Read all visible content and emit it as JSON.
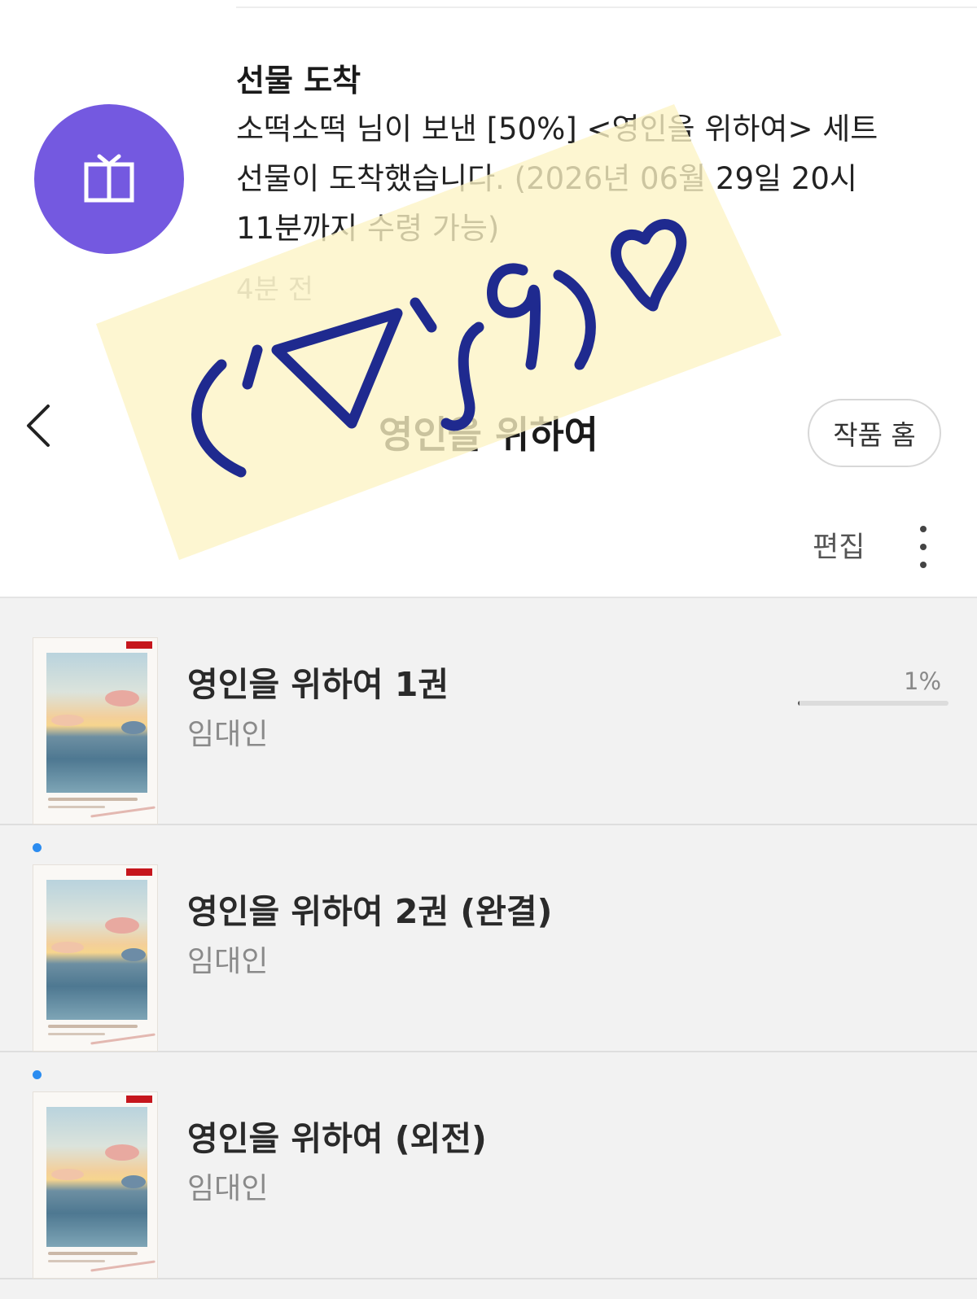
{
  "notification": {
    "title": "선물 도착",
    "line1": "소떡소떡 님이 보낸 [50%] <영인을 위하여> 세트",
    "line2": "선물이 도착했습니다. (2026년 06월 29일 20시",
    "line3": "11분까지 수령 가능)",
    "time": "4분 전",
    "icon": "gift-icon",
    "accent": "#7459e0"
  },
  "header": {
    "back_icon": "chevron-left-icon",
    "title": "영인을 위하여",
    "home_button": "작품 홈"
  },
  "toolbar": {
    "edit_label": "편집",
    "more_icon": "more-vertical-icon"
  },
  "books": [
    {
      "title": "영인을 위하여 1권",
      "author": "임대인",
      "progress_label": "1%",
      "progress": 0.01,
      "unread": false
    },
    {
      "title": "영인을 위하여 2권 (완결)",
      "author": "임대인",
      "unread": true
    },
    {
      "title": "영인을 위하여 (외전)",
      "author": "임대인",
      "unread": true
    }
  ],
  "sticker": {
    "emoticon": "(´▽`ʃ♡ƪ)♡",
    "note_color": "#fdf3c4",
    "ink_color": "#1f2a8f"
  }
}
